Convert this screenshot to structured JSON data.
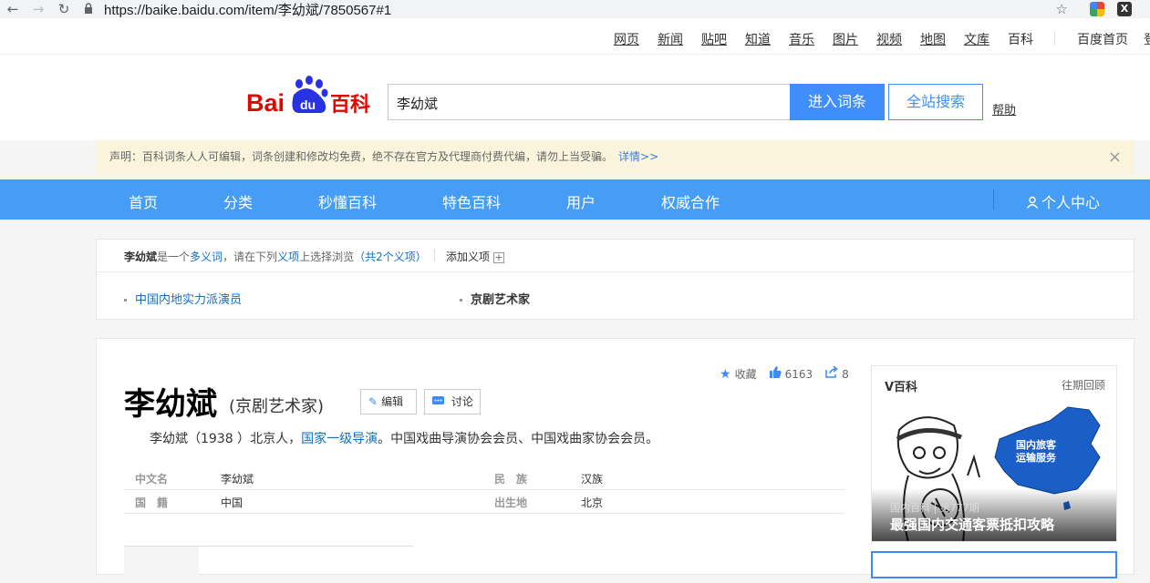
{
  "browser": {
    "url": "https://baike.baidu.com/item/李幼斌/7850567#1"
  },
  "topnav": {
    "items": [
      "网页",
      "新闻",
      "贴吧",
      "知道",
      "音乐",
      "图片",
      "视频",
      "地图",
      "文库",
      "百科"
    ],
    "home": "百度首页",
    "login": "登"
  },
  "header": {
    "logo_text": "Bai",
    "logo_du": "du",
    "logo_baike": "百科",
    "search_value": "李幼斌",
    "enter_button": "进入词条",
    "all_search_button": "全站搜索",
    "help": "帮助"
  },
  "notice": {
    "text": "声明：百科词条人人可编辑，词条创建和修改均免费，绝不存在官方及代理商付费代编，请勿上当受骗。",
    "more": "详情>>"
  },
  "bluenav": {
    "items": [
      "首页",
      "分类",
      "秒懂百科",
      "特色百科",
      "用户",
      "权威合作"
    ],
    "user_center": "个人中心"
  },
  "polysemant": {
    "term": "李幼斌",
    "pre": "是一个",
    "multi": "多义词",
    "mid": "，请在下列",
    "yixiang": "义项",
    "post": "上选择浏览",
    "count": "（共2个义项）",
    "add": "添加义项",
    "items": [
      "中国内地实力派演员",
      "京剧艺术家"
    ]
  },
  "lemma": {
    "title": "李幼斌",
    "subtitle": "(京剧艺术家)",
    "edit": "编辑",
    "discuss": "讨论",
    "collect": "收藏",
    "likes": "6163",
    "shares": "8",
    "summary_pre": "李幼斌（1938 ）北京人，",
    "summary_link": "国家一级导演",
    "summary_post": "。中国戏曲导演协会会员、中国戏曲家协会会员。",
    "basic_info": [
      {
        "k1": "中文名",
        "v1": "李幼斌",
        "k2": "民　族",
        "v2": "汉族"
      },
      {
        "k1": "国　籍",
        "v1": "中国",
        "k2": "出生地",
        "v2": "北京"
      }
    ]
  },
  "side": {
    "title": "V百科",
    "past": "往期回顾",
    "map_text1": "国内旅客",
    "map_text2": "运输服务",
    "caption_small": "国内百科 | 第777期",
    "caption_big": "最强国内交通客票抵扣攻略"
  }
}
